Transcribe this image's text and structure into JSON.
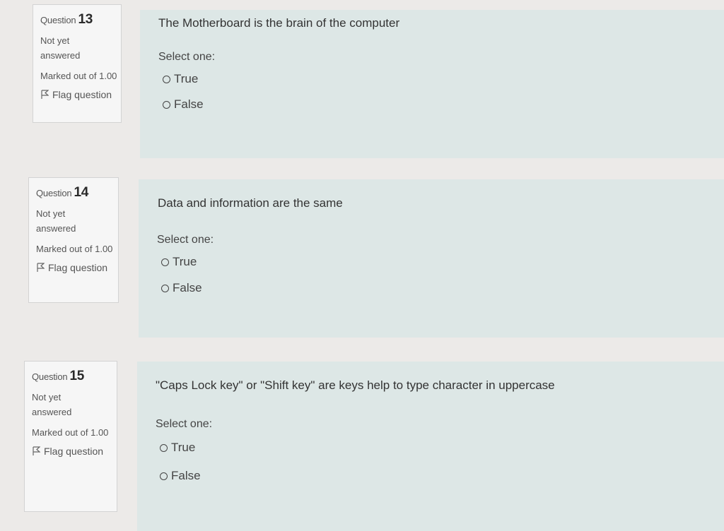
{
  "quiz": {
    "questions": [
      {
        "label": "Question",
        "number": "13",
        "state": "Not yet answered",
        "grade": "Marked out of 1.00",
        "flag_label": "Flag question",
        "text": "The Motherboard is the brain of the computer",
        "prompt": "Select one:",
        "options": [
          "True",
          "False"
        ]
      },
      {
        "label": "Question",
        "number": "14",
        "state": "Not yet answered",
        "grade": "Marked out of 1.00",
        "flag_label": "Flag question",
        "text": "Data and information are the same",
        "prompt": "Select one:",
        "options": [
          "True",
          "False"
        ]
      },
      {
        "label": "Question",
        "number": "15",
        "state": "Not yet answered",
        "grade": "Marked out of 1.00",
        "flag_label": "Flag question",
        "text": "\"Caps Lock key\" or \"Shift key\" are keys help to type character in uppercase",
        "prompt": "Select one:",
        "options": [
          "True",
          "False"
        ]
      }
    ]
  },
  "icons": {
    "flag": "flag-icon",
    "radio": "radio-unchecked-icon"
  },
  "colors": {
    "page_background": "#eceae8",
    "info_background": "#f6f6f6",
    "content_background": "#dde7e6"
  }
}
